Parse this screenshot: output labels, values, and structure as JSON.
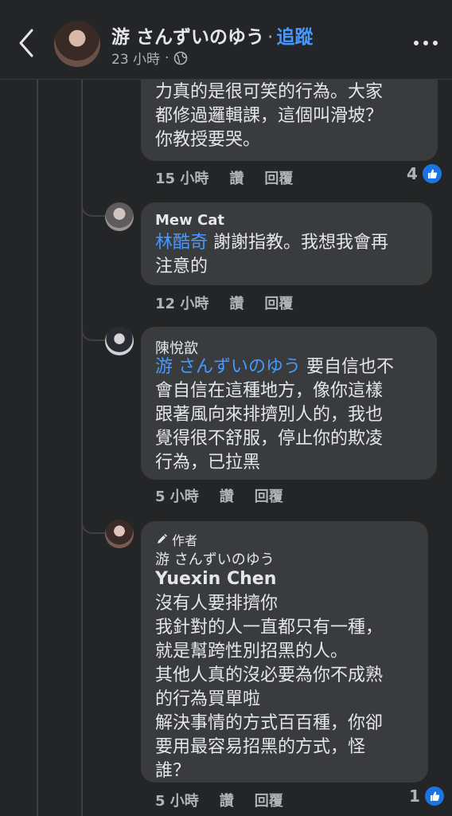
{
  "header": {
    "name": "游 さんずいのゆう",
    "separator": "·",
    "follow_label": "追蹤",
    "timestamp": "23 小時",
    "icons": {
      "back": "chevron-left-icon",
      "privacy": "globe-icon",
      "more": "more-horizontal-icon"
    }
  },
  "comments": [
    {
      "text": "力真的是很可笑的行為。大家\n都修過邏輯課，這個叫滑坡？\n你教授要哭。",
      "time": "15 小時",
      "like_label": "讚",
      "reply_label": "回覆",
      "reaction_count": "4"
    },
    {
      "author": "Mew Cat",
      "mention": "林酷奇",
      "text_line1": " 謝謝指教。我想我會再",
      "text_rest": "注意的",
      "time": "12 小時",
      "like_label": "讚",
      "reply_label": "回覆"
    },
    {
      "author": "陳悅歆",
      "mention": "游 さんずいのゆう",
      "text_line1": " 要自信也不",
      "text_rest": "會自信在這種地方，像你這樣\n跟著風向來排擠別人的，我也\n覺得很不舒服，停止你的欺凌\n行為，已拉黑",
      "time": "5 小時",
      "like_label": "讚",
      "reply_label": "回覆"
    },
    {
      "badge": "作者",
      "author": "游 さんずいのゆう",
      "tagged": "Yuexin Chen",
      "text": "沒有人要排擠你\n我針對的人一直都只有一種，\n就是幫跨性別招黑的人。\n其他人真的沒必要為你不成熟\n的行為買單啦\n解決事情的方式百百種，你卻\n要用最容易招黑的方式，怪\n誰？",
      "time": "5 小時",
      "like_label": "讚",
      "reply_label": "回覆",
      "reaction_count": "1"
    }
  ],
  "colors": {
    "background": "#242526",
    "bubble": "#3a3b3c",
    "mention": "#4599ff",
    "like": "#1b74e4"
  }
}
